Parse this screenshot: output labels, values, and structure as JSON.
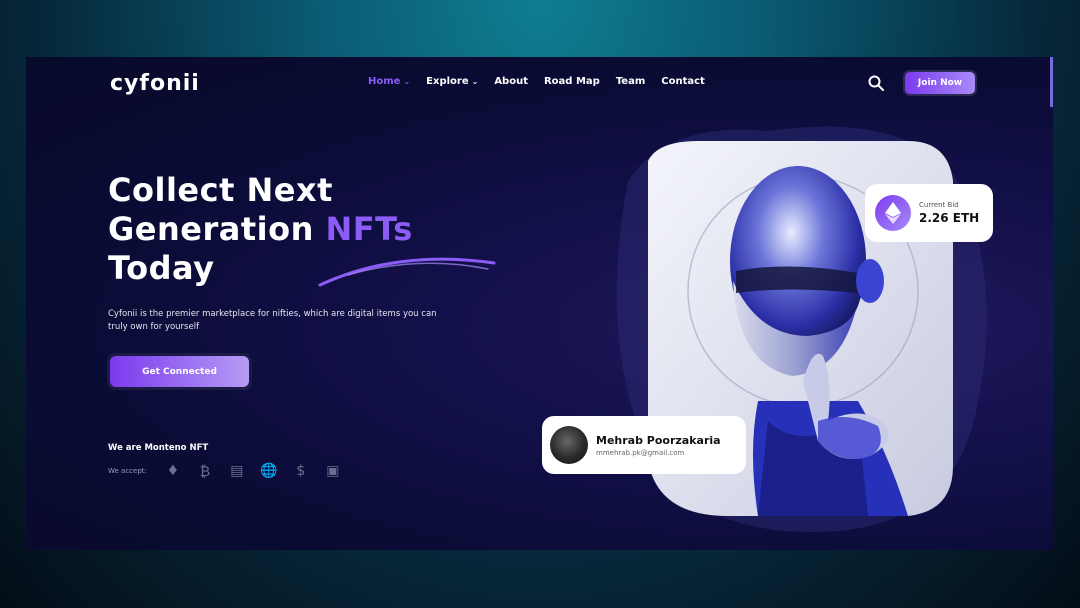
{
  "brand": {
    "logo": "cyfonii"
  },
  "nav": {
    "items": [
      {
        "label": "Home",
        "active": true,
        "dropdown": true
      },
      {
        "label": "Explore",
        "active": false,
        "dropdown": true
      },
      {
        "label": "About",
        "active": false,
        "dropdown": false
      },
      {
        "label": "Road Map",
        "active": false,
        "dropdown": false
      },
      {
        "label": "Team",
        "active": false,
        "dropdown": false
      },
      {
        "label": "Contact",
        "active": false,
        "dropdown": false
      }
    ],
    "search_icon": "search-icon",
    "join_label": "Join Now"
  },
  "hero": {
    "title_line1": "Collect Next",
    "title_line2_a": "Generation ",
    "title_line2_b": "NFTs",
    "title_line3": "Today",
    "description": "Cyfonii is the premier marketplace for nifties, which are digital items you can truly own for yourself",
    "cta_label": "Get Connected",
    "we_are": "We are Monteno NFT",
    "accept_label": "We accept:",
    "payment_icons": [
      "ethereum-icon",
      "bitcoin-icon",
      "wallet-icon",
      "globe-icon",
      "dollar-icon",
      "cash-icon"
    ]
  },
  "bid_card": {
    "label": "Current Bid",
    "value": "2.26 ETH"
  },
  "user_card": {
    "name": "Mehrab Poorzakaria",
    "email": "mmehrab.pk@gmail.com"
  },
  "colors": {
    "accent": "#8b5cf6",
    "background": "#0a0b33",
    "button_start": "#7c3aed",
    "button_end": "#a78bfa"
  }
}
